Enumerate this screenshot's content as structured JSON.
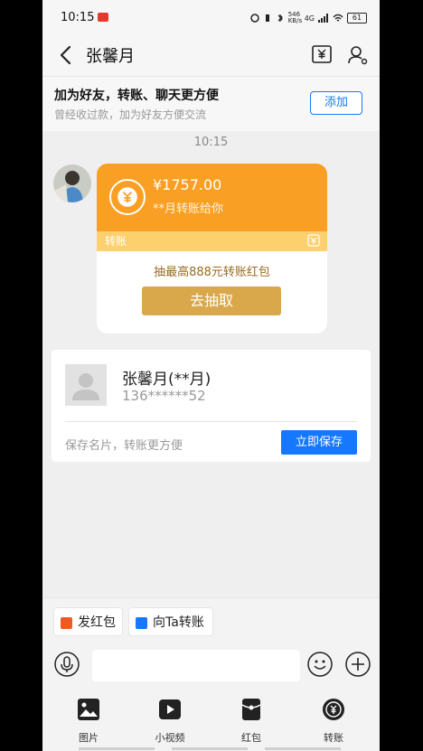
{
  "status_bar": {
    "time": "10:15",
    "net_speed": "546 KB/s",
    "signal": "4G",
    "battery": "61"
  },
  "header": {
    "title": "张馨月",
    "back_icon": "back-arrow-icon",
    "transfer_icon": "yuan-transfer-icon",
    "profile_icon": "person-settings-icon"
  },
  "banner": {
    "title": "加为好友，转账、聊天更方便",
    "subtitle": "曾经收过款，加为好友方便交流",
    "add_button": "添加"
  },
  "message_time": "10:15",
  "transfer_card": {
    "amount": "¥1757.00",
    "note": "**月转账给你",
    "type_label": "转账",
    "promo": "抽最高888元转账红包",
    "draw_button": "去抽取",
    "colors": {
      "top": "#f9a024",
      "band": "#fdd06e",
      "button": "#d9a84a"
    }
  },
  "contact_card": {
    "name": "张馨月(**月)",
    "phone": "136******52",
    "save_tip": "保存名片，转账更方便",
    "save_button": "立即保存"
  },
  "quick_actions": [
    {
      "label": "发红包",
      "icon": "red-packet-icon"
    },
    {
      "label": "向Ta转账",
      "icon": "transfer-icon"
    }
  ],
  "input": {
    "placeholder": ""
  },
  "toolbar": [
    {
      "label": "图片",
      "icon": "image-icon"
    },
    {
      "label": "小视频",
      "icon": "video-icon"
    },
    {
      "label": "红包",
      "icon": "red-packet-icon"
    },
    {
      "label": "转账",
      "icon": "transfer-icon"
    }
  ],
  "colors": {
    "accent": "#1677ff",
    "orange": "#f9a024"
  }
}
